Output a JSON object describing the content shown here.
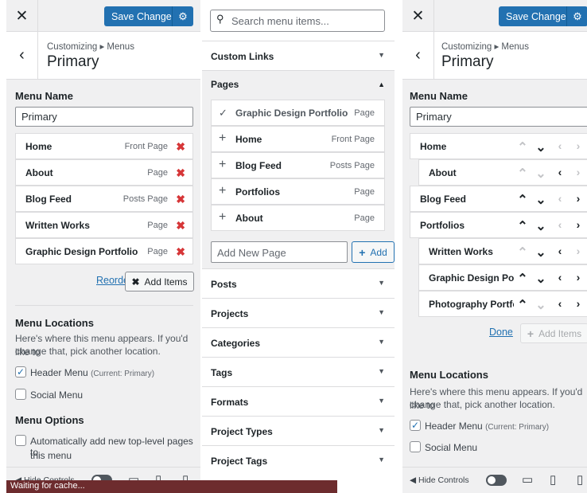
{
  "left": {
    "save_label": "Save Changes",
    "breadcrumb": "Customizing ▸ Menus",
    "title": "Primary",
    "menu_name_heading": "Menu Name",
    "menu_name_value": "Primary",
    "items": [
      {
        "label": "Home",
        "type": "Front Page"
      },
      {
        "label": "About",
        "type": "Page"
      },
      {
        "label": "Blog Feed",
        "type": "Posts Page"
      },
      {
        "label": "Written Works",
        "type": "Page"
      },
      {
        "label": "Graphic Design Portfolio",
        "type": "Page"
      }
    ],
    "reorder_label": "Reorder",
    "add_items_label": "Add Items",
    "locations_heading": "Menu Locations",
    "locations_desc_1": "Here's where this menu appears. If you'd like to",
    "locations_desc_2": "change that, pick another location.",
    "header_menu_label": "Header Menu",
    "header_menu_note": "(Current: Primary)",
    "header_menu_checked": true,
    "social_menu_label": "Social Menu",
    "social_menu_checked": false,
    "options_heading": "Menu Options",
    "auto_add_label_1": "Automatically add new top-level pages to",
    "auto_add_label_2": "this menu",
    "hide_controls": "Hide Controls",
    "status": "Waiting for cache..."
  },
  "middle": {
    "search_placeholder": "Search menu items...",
    "sections_top": [
      "Custom Links"
    ],
    "pages_label": "Pages",
    "pages": [
      {
        "label": "Graphic Design Portfolio",
        "type": "Page",
        "added": true
      },
      {
        "label": "Home",
        "type": "Front Page",
        "added": false
      },
      {
        "label": "Blog Feed",
        "type": "Posts Page",
        "added": false
      },
      {
        "label": "Portfolios",
        "type": "Page",
        "added": false
      },
      {
        "label": "About",
        "type": "Page",
        "added": false
      }
    ],
    "add_new_placeholder": "Add New Page",
    "add_label": "Add",
    "sections_bottom": [
      "Posts",
      "Projects",
      "Categories",
      "Tags",
      "Formats",
      "Project Types",
      "Project Tags"
    ]
  },
  "right": {
    "save_label": "Save Changes",
    "breadcrumb": "Customizing ▸ Menus",
    "title": "Primary",
    "menu_name_heading": "Menu Name",
    "menu_name_value": "Primary",
    "items": [
      {
        "label": "Home",
        "level": 0,
        "up": false,
        "down": true,
        "left": false,
        "right": false
      },
      {
        "label": "About",
        "level": 1,
        "up": false,
        "down": false,
        "left": true,
        "right": false
      },
      {
        "label": "Blog Feed",
        "level": 0,
        "up": true,
        "down": true,
        "left": false,
        "right": true
      },
      {
        "label": "Portfolios",
        "level": 0,
        "up": true,
        "down": true,
        "left": false,
        "right": true
      },
      {
        "label": "Written Works",
        "level": 1,
        "up": false,
        "down": true,
        "left": true,
        "right": false
      },
      {
        "label": "Graphic Design Portfolio",
        "level": 1,
        "up": true,
        "down": true,
        "left": true,
        "right": true
      },
      {
        "label": "Photography Portfolio",
        "level": 1,
        "up": true,
        "down": false,
        "left": true,
        "right": true
      }
    ],
    "done_label": "Done",
    "add_items_label": "Add Items",
    "locations_heading": "Menu Locations",
    "locations_desc_1": "Here's where this menu appears. If you'd like to",
    "locations_desc_2": "change that, pick another location.",
    "header_menu_label": "Header Menu",
    "header_menu_note": "(Current: Primary)",
    "social_menu_label": "Social Menu",
    "hide_controls": "Hide Controls"
  },
  "colors": {
    "accent": "#2271b1",
    "delete": "#d63638",
    "status_bar": "#6d2c2e"
  },
  "icons": {
    "close": "close-icon",
    "gear": "gear-icon",
    "back": "chevron-left-icon",
    "search": "search-icon",
    "plus": "plus-icon",
    "check": "checkmark-icon",
    "remove": "remove-x-icon"
  }
}
